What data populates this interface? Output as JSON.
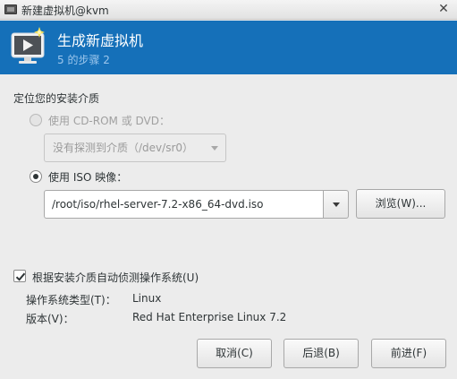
{
  "window": {
    "title": "新建虚拟机@kvm",
    "close_glyph": "✕"
  },
  "header": {
    "title": "生成新虚拟机",
    "step": "5 的步骤 2",
    "icon": "monitor-icon",
    "accent_color": "#1570b9"
  },
  "media": {
    "section_label": "定位您的安装介质",
    "cdrom_option": {
      "label": "使用 CD-ROM 或 DVD：",
      "selected": false,
      "enabled": false
    },
    "cdrom_combo_value": "没有探测到介质（/dev/sr0）",
    "iso_option": {
      "label": "使用 ISO 映像：",
      "selected": true,
      "enabled": true
    },
    "iso_path": "/root/iso/rhel-server-7.2-x86_64-dvd.iso",
    "browse_label": "浏览(W)..."
  },
  "os_detect": {
    "checkbox_label": "根据安装介质自动侦测操作系统(U)",
    "checked": true,
    "os_type_label": "操作系统类型(T)：",
    "os_type_value": "Linux",
    "version_label": "版本(V)：",
    "version_value": "Red Hat Enterprise Linux 7.2"
  },
  "buttons": {
    "cancel": "取消(C)",
    "back": "后退(B)",
    "forward": "前进(F)"
  }
}
